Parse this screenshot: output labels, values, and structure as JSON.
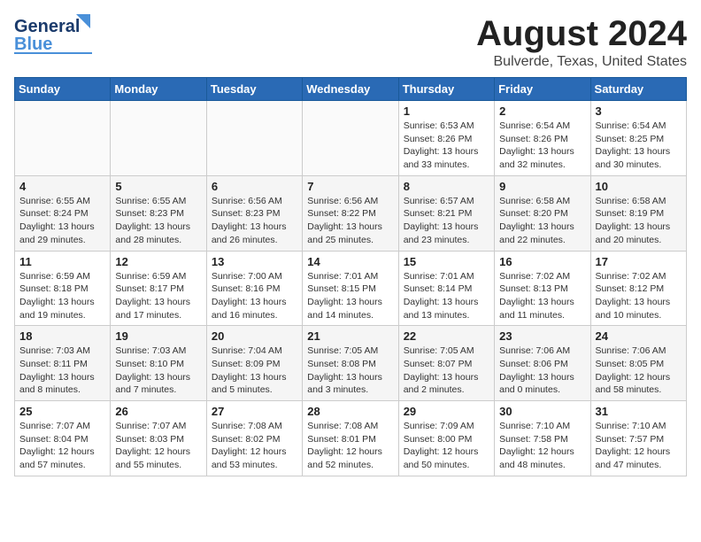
{
  "header": {
    "logo_general": "General",
    "logo_blue": "Blue",
    "title": "August 2024",
    "subtitle": "Bulverde, Texas, United States"
  },
  "weekdays": [
    "Sunday",
    "Monday",
    "Tuesday",
    "Wednesday",
    "Thursday",
    "Friday",
    "Saturday"
  ],
  "weeks": [
    [
      {
        "day": "",
        "info": ""
      },
      {
        "day": "",
        "info": ""
      },
      {
        "day": "",
        "info": ""
      },
      {
        "day": "",
        "info": ""
      },
      {
        "day": "1",
        "info": "Sunrise: 6:53 AM\nSunset: 8:26 PM\nDaylight: 13 hours\nand 33 minutes."
      },
      {
        "day": "2",
        "info": "Sunrise: 6:54 AM\nSunset: 8:26 PM\nDaylight: 13 hours\nand 32 minutes."
      },
      {
        "day": "3",
        "info": "Sunrise: 6:54 AM\nSunset: 8:25 PM\nDaylight: 13 hours\nand 30 minutes."
      }
    ],
    [
      {
        "day": "4",
        "info": "Sunrise: 6:55 AM\nSunset: 8:24 PM\nDaylight: 13 hours\nand 29 minutes."
      },
      {
        "day": "5",
        "info": "Sunrise: 6:55 AM\nSunset: 8:23 PM\nDaylight: 13 hours\nand 28 minutes."
      },
      {
        "day": "6",
        "info": "Sunrise: 6:56 AM\nSunset: 8:23 PM\nDaylight: 13 hours\nand 26 minutes."
      },
      {
        "day": "7",
        "info": "Sunrise: 6:56 AM\nSunset: 8:22 PM\nDaylight: 13 hours\nand 25 minutes."
      },
      {
        "day": "8",
        "info": "Sunrise: 6:57 AM\nSunset: 8:21 PM\nDaylight: 13 hours\nand 23 minutes."
      },
      {
        "day": "9",
        "info": "Sunrise: 6:58 AM\nSunset: 8:20 PM\nDaylight: 13 hours\nand 22 minutes."
      },
      {
        "day": "10",
        "info": "Sunrise: 6:58 AM\nSunset: 8:19 PM\nDaylight: 13 hours\nand 20 minutes."
      }
    ],
    [
      {
        "day": "11",
        "info": "Sunrise: 6:59 AM\nSunset: 8:18 PM\nDaylight: 13 hours\nand 19 minutes."
      },
      {
        "day": "12",
        "info": "Sunrise: 6:59 AM\nSunset: 8:17 PM\nDaylight: 13 hours\nand 17 minutes."
      },
      {
        "day": "13",
        "info": "Sunrise: 7:00 AM\nSunset: 8:16 PM\nDaylight: 13 hours\nand 16 minutes."
      },
      {
        "day": "14",
        "info": "Sunrise: 7:01 AM\nSunset: 8:15 PM\nDaylight: 13 hours\nand 14 minutes."
      },
      {
        "day": "15",
        "info": "Sunrise: 7:01 AM\nSunset: 8:14 PM\nDaylight: 13 hours\nand 13 minutes."
      },
      {
        "day": "16",
        "info": "Sunrise: 7:02 AM\nSunset: 8:13 PM\nDaylight: 13 hours\nand 11 minutes."
      },
      {
        "day": "17",
        "info": "Sunrise: 7:02 AM\nSunset: 8:12 PM\nDaylight: 13 hours\nand 10 minutes."
      }
    ],
    [
      {
        "day": "18",
        "info": "Sunrise: 7:03 AM\nSunset: 8:11 PM\nDaylight: 13 hours\nand 8 minutes."
      },
      {
        "day": "19",
        "info": "Sunrise: 7:03 AM\nSunset: 8:10 PM\nDaylight: 13 hours\nand 7 minutes."
      },
      {
        "day": "20",
        "info": "Sunrise: 7:04 AM\nSunset: 8:09 PM\nDaylight: 13 hours\nand 5 minutes."
      },
      {
        "day": "21",
        "info": "Sunrise: 7:05 AM\nSunset: 8:08 PM\nDaylight: 13 hours\nand 3 minutes."
      },
      {
        "day": "22",
        "info": "Sunrise: 7:05 AM\nSunset: 8:07 PM\nDaylight: 13 hours\nand 2 minutes."
      },
      {
        "day": "23",
        "info": "Sunrise: 7:06 AM\nSunset: 8:06 PM\nDaylight: 13 hours\nand 0 minutes."
      },
      {
        "day": "24",
        "info": "Sunrise: 7:06 AM\nSunset: 8:05 PM\nDaylight: 12 hours\nand 58 minutes."
      }
    ],
    [
      {
        "day": "25",
        "info": "Sunrise: 7:07 AM\nSunset: 8:04 PM\nDaylight: 12 hours\nand 57 minutes."
      },
      {
        "day": "26",
        "info": "Sunrise: 7:07 AM\nSunset: 8:03 PM\nDaylight: 12 hours\nand 55 minutes."
      },
      {
        "day": "27",
        "info": "Sunrise: 7:08 AM\nSunset: 8:02 PM\nDaylight: 12 hours\nand 53 minutes."
      },
      {
        "day": "28",
        "info": "Sunrise: 7:08 AM\nSunset: 8:01 PM\nDaylight: 12 hours\nand 52 minutes."
      },
      {
        "day": "29",
        "info": "Sunrise: 7:09 AM\nSunset: 8:00 PM\nDaylight: 12 hours\nand 50 minutes."
      },
      {
        "day": "30",
        "info": "Sunrise: 7:10 AM\nSunset: 7:58 PM\nDaylight: 12 hours\nand 48 minutes."
      },
      {
        "day": "31",
        "info": "Sunrise: 7:10 AM\nSunset: 7:57 PM\nDaylight: 12 hours\nand 47 minutes."
      }
    ]
  ]
}
